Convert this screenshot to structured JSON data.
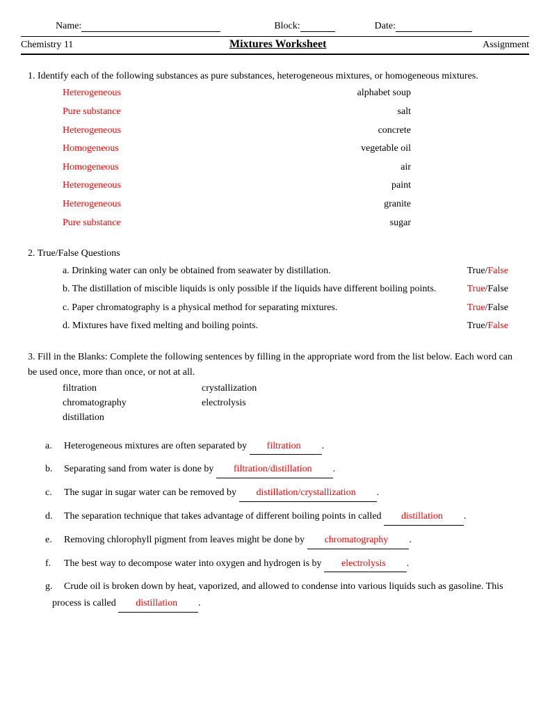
{
  "header": {
    "name_label": "Name:",
    "block_label": "Block:",
    "date_label": "Date:"
  },
  "title_row": {
    "left": "Chemistry 11",
    "center": "Mixtures Worksheet",
    "right": "Assignment"
  },
  "q1": {
    "prompt": "1. Identify each of the following substances as pure substances, heterogeneous mixtures, or homogeneous mixtures.",
    "rows": [
      {
        "answer": "Heterogeneous",
        "item": "alphabet soup"
      },
      {
        "answer": "Pure substance",
        "item": "salt"
      },
      {
        "answer": "Heterogeneous",
        "item": "concrete"
      },
      {
        "answer": "Homogeneous",
        "item": "vegetable oil"
      },
      {
        "answer": "Homogeneous",
        "item": "air"
      },
      {
        "answer": "Heterogeneous",
        "item": "paint"
      },
      {
        "answer": "Heterogeneous",
        "item": "granite"
      },
      {
        "answer": "Pure substance",
        "item": "sugar"
      }
    ]
  },
  "q2": {
    "prompt": "2. True/False Questions",
    "items": [
      {
        "letter": "a.",
        "text": "Drinking water can only be obtained from seawater by distillation.",
        "true": "True",
        "slash": "/",
        "false": "False",
        "answer": "False"
      },
      {
        "letter": "b.",
        "text": "The distillation of miscible liquids is only possible if the liquids have different boiling points.",
        "true": "True",
        "slash": "/",
        "false": "False",
        "answer": "True"
      },
      {
        "letter": "c.",
        "text": "Paper chromatography is a physical method for separating mixtures.",
        "true": "True",
        "slash": "/",
        "false": "False",
        "answer": "True"
      },
      {
        "letter": "d.",
        "text": "Mixtures have fixed melting and boiling points.",
        "true": "True",
        "slash": "/",
        "false": "False",
        "answer": "False"
      }
    ]
  },
  "q3": {
    "prompt": "3. Fill in the Blanks: Complete the following sentences by filling in the appropriate word from the list below. Each word can be used once, more than once, or not at all.",
    "words": {
      "r1c1": "filtration",
      "r1c2": "crystallization",
      "r2c1": "chromatography",
      "r2c2": "electrolysis",
      "r3c1": "distillation"
    },
    "items": [
      {
        "letter": "a.",
        "pre": "Heterogeneous mixtures are often separated by ",
        "ans": "filtration",
        "post": "."
      },
      {
        "letter": "b.",
        "pre": "Separating sand from water is done by ",
        "ans": "filtration/distillation",
        "post": "."
      },
      {
        "letter": "c.",
        "pre": "The sugar in sugar water can be removed by ",
        "ans": "distillation/crystallization",
        "post": "."
      },
      {
        "letter": "d.",
        "pre": "The separation technique that takes advantage of different boiling points in called ",
        "ans": "distillation",
        "post": "."
      },
      {
        "letter": "e.",
        "pre": "Removing chlorophyll pigment from leaves might be done by ",
        "ans": "chromatography",
        "post": "."
      },
      {
        "letter": "f.",
        "pre": "The best way to decompose water into oxygen and hydrogen is by ",
        "ans": "electrolysis",
        "post": "."
      },
      {
        "letter": "g.",
        "pre": "Crude oil is broken down by heat, vaporized, and allowed to condense into various liquids such as gasoline.  This process is called ",
        "ans": "distillation",
        "post": "."
      }
    ]
  }
}
